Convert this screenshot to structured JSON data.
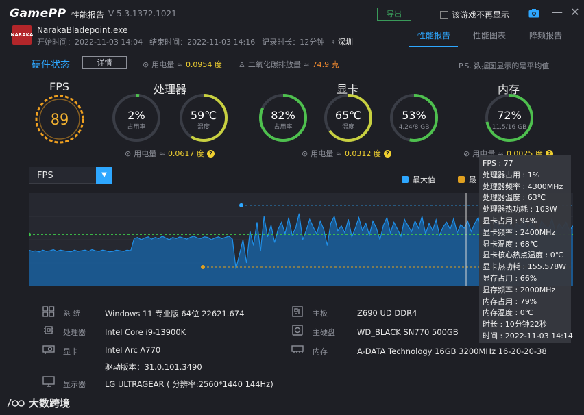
{
  "titlebar": {
    "logo": "GamePP",
    "report_title": "性能报告",
    "version": "V 5.3.1372.1021",
    "export_label": "导出",
    "noshow_label": "该游戏不再显示"
  },
  "session": {
    "exe": "NarakaBladepoint.exe",
    "icon_text": "NARAKA",
    "start": "开始时间：2022-11-03 14:04",
    "end": "结束时间：2022-11-03 14:16",
    "duration": "记录时长：12分钟",
    "city": "深圳"
  },
  "tabs": [
    {
      "label": "性能报告",
      "active": true
    },
    {
      "label": "性能图表",
      "active": false
    },
    {
      "label": "降频报告",
      "active": false
    }
  ],
  "hw": {
    "title": "硬件状态",
    "detail_label": "详情",
    "power_label": "用电量 ≈",
    "power_value": "0.0954 度",
    "co2_label": "二氧化碳排放量 ≈",
    "co2_value": "74.9 克",
    "note": "P.S. 数据图显示的是平均值"
  },
  "sections": {
    "fps": {
      "title": "FPS",
      "value": "89"
    },
    "cpu": {
      "title": "处理器",
      "usage": {
        "value": "2%",
        "sub": "占用率",
        "fraction": 0.02
      },
      "temp": {
        "value": "59℃",
        "sub": "温度",
        "fraction": 0.59
      },
      "power_label": "用电量 ≈",
      "power_value": "0.0617 度"
    },
    "gpu": {
      "title": "显卡",
      "usage": {
        "value": "82%",
        "sub": "占用率",
        "fraction": 0.82
      },
      "temp": {
        "value": "65℃",
        "sub": "温度",
        "fraction": 0.65
      },
      "mem": {
        "value": "53%",
        "sub": "4.24/8 GB",
        "fraction": 0.53
      },
      "power_label": "用电量 ≈",
      "power_value": "0.0312 度"
    },
    "ram": {
      "title": "内存",
      "usage": {
        "value": "72%",
        "sub": "11.5/16 GB",
        "fraction": 0.72
      },
      "power_label": "用电量 ≈",
      "power_value": "0.0025 度"
    }
  },
  "chart": {
    "metric": "FPS",
    "legend_max": "最大值",
    "legend_avg": "最",
    "colors": {
      "line": "#1f8fe8",
      "fill": "#1a5f9e",
      "max": "#2ea7ff",
      "min": "#e0a020",
      "avg": "#3ec84a"
    }
  },
  "chart_data": {
    "type": "area",
    "title": "FPS",
    "xlabel": "",
    "ylabel": "",
    "ylim": [
      0,
      160
    ],
    "series": [
      {
        "name": "FPS",
        "values": [
          62,
          60,
          61,
          59,
          62,
          60,
          61,
          63,
          60,
          62,
          61,
          60,
          59,
          62,
          60,
          61,
          62,
          60,
          63,
          61,
          60,
          62,
          61,
          59,
          60,
          62,
          61,
          60,
          62,
          61,
          82,
          84,
          80,
          83,
          85,
          81,
          84,
          82,
          86,
          83,
          80,
          84,
          82,
          85,
          83,
          81,
          84,
          86,
          83,
          82,
          85,
          84,
          80,
          83,
          85,
          82,
          84,
          86,
          81,
          30,
          55,
          80,
          40,
          95,
          70,
          110,
          60,
          120,
          85,
          105,
          75,
          98,
          110,
          90,
          118,
          88,
          100,
          125,
          80,
          96,
          115,
          102,
          90,
          112,
          98,
          70,
          108,
          120,
          95,
          104,
          92,
          115,
          85,
          100,
          118,
          96,
          108,
          88,
          112,
          100,
          80,
          105,
          118,
          92,
          110,
          98,
          86,
          115,
          104,
          94,
          112,
          100,
          120,
          90,
          108,
          96,
          114,
          88,
          102,
          110,
          98,
          116,
          92,
          106,
          100,
          112,
          94,
          108,
          118,
          96,
          104,
          110,
          90,
          114,
          100,
          106,
          98,
          112,
          94,
          108,
          102,
          116,
          96,
          110,
          100,
          88,
          112,
          104,
          98,
          116,
          92,
          108,
          100,
          110,
          96,
          104
        ]
      }
    ],
    "max": 139,
    "min": 33,
    "avg": 89
  },
  "tooltip": [
    "FPS : 77",
    "处理器占用 : 1%",
    "处理器频率 : 4300MHz",
    "处理器温度 : 63℃",
    "处理器热功耗 : 103W",
    "显卡占用 : 94%",
    "显卡频率 : 2400MHz",
    "显卡温度 : 68℃",
    "显卡核心热点温度 : 0℃",
    "显卡热功耗 : 155.578W",
    "显存占用 : 66%",
    "显存频率 : 2000MHz",
    "内存占用 : 79%",
    "内存温度 : 0℃",
    "时长 : 10分钟22秒",
    "时间 : 2022-11-03 14:14"
  ],
  "specs": {
    "os": {
      "label": "系  统",
      "value": "Windows 11 专业版 64位 22621.674"
    },
    "cpu": {
      "label": "处理器",
      "value": "Intel Core i9-13900K"
    },
    "gpu": {
      "label": "显卡",
      "value": "Intel Arc A770",
      "driver": "驱动版本：31.0.101.3490"
    },
    "monitor": {
      "label": "显示器",
      "value": "LG ULTRAGEAR ( 分辨率:2560*1440 144Hz)"
    },
    "board": {
      "label": "主板",
      "value": "Z690 UD DDR4"
    },
    "disk": {
      "label": "主硬盘",
      "value": "WD_BLACK SN770 500GB"
    },
    "ram": {
      "label": "内存",
      "value": "A-DATA Technology 16GB 3200MHz 16-20-20-38"
    }
  },
  "watermark": "大数跨境"
}
